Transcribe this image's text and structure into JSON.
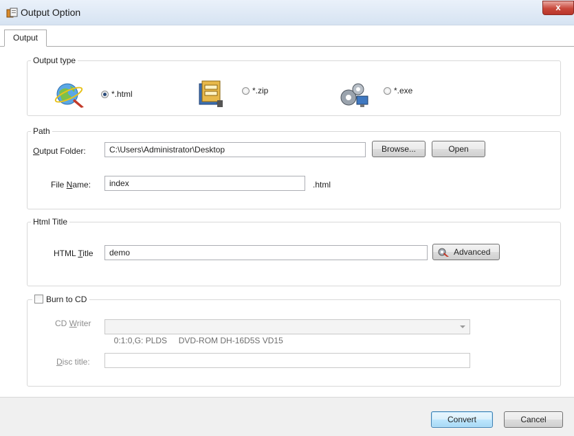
{
  "window": {
    "title": "Output Option",
    "close_glyph": "x"
  },
  "tabs": [
    {
      "label": "Output"
    }
  ],
  "output_type": {
    "legend": "Output type",
    "options": [
      {
        "label": "*.html",
        "selected": true,
        "icon": "globe-icon"
      },
      {
        "label": "*.zip",
        "selected": false,
        "icon": "zip-archive-icon"
      },
      {
        "label": "*.exe",
        "selected": false,
        "icon": "gears-computer-icon"
      }
    ]
  },
  "path": {
    "legend": "Path",
    "output_folder_label": "Output Folder:",
    "output_folder_value": "C:\\Users\\Administrator\\Desktop",
    "browse_label": "Browse...",
    "open_label": "Open",
    "file_name_label": "File Name:",
    "file_name_value": "index",
    "file_ext": ".html"
  },
  "html_title": {
    "legend": "Html Title",
    "label": "HTML Title",
    "value": "demo",
    "advanced_label": "Advanced"
  },
  "burn": {
    "checkbox_label": "Burn to CD",
    "checked": false,
    "cd_writer_label": "CD Writer",
    "cd_writer_value": "0:1:0,G: PLDS     DVD-ROM DH-16D5S VD15",
    "disc_title_label": "Disc title:",
    "disc_title_value": ""
  },
  "footer": {
    "convert_label": "Convert",
    "cancel_label": "Cancel"
  }
}
